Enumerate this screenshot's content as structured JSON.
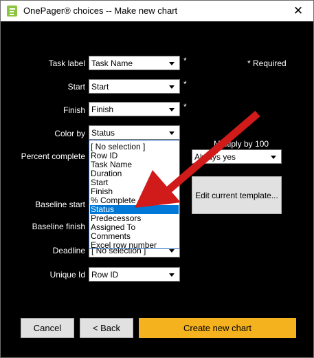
{
  "window": {
    "title": "OnePager® choices -- Make new chart",
    "app_icon": "onepager-logo-icon",
    "close_glyph": "✕"
  },
  "form": {
    "required_marker": "*",
    "required_note": "* Required",
    "task_label": {
      "label": "Task label",
      "value": "Task Name"
    },
    "start": {
      "label": "Start",
      "value": "Start"
    },
    "finish": {
      "label": "Finish",
      "value": "Finish"
    },
    "color_by": {
      "label": "Color by",
      "value": "Status"
    },
    "percent_complete": {
      "label": "Percent complete"
    },
    "baseline_start": {
      "label": "Baseline start"
    },
    "baseline_finish": {
      "label": "Baseline finish"
    },
    "deadline": {
      "label": "Deadline",
      "value": "[ No selection ]"
    },
    "unique_id": {
      "label": "Unique Id",
      "value": "Row ID"
    },
    "multiply": {
      "label": "Multiply by 100",
      "value": "Always yes"
    }
  },
  "dropdown": {
    "selected_index": 7,
    "options": [
      "[ No selection ]",
      "Row ID",
      "Task Name",
      "Duration",
      "Start",
      "Finish",
      "% Complete",
      "Status",
      "Predecessors",
      "Assigned To",
      "Comments",
      "Excel row number"
    ]
  },
  "buttons": {
    "edit_template": "Edit current template...",
    "cancel": "Cancel",
    "back": "< Back",
    "create": "Create new chart"
  },
  "annotation": {
    "arrow_color": "#d11a1a",
    "icon": "red-arrow-icon"
  },
  "colors": {
    "background": "#000000",
    "primary_button": "#f4b21e",
    "selection": "#0078d7"
  }
}
